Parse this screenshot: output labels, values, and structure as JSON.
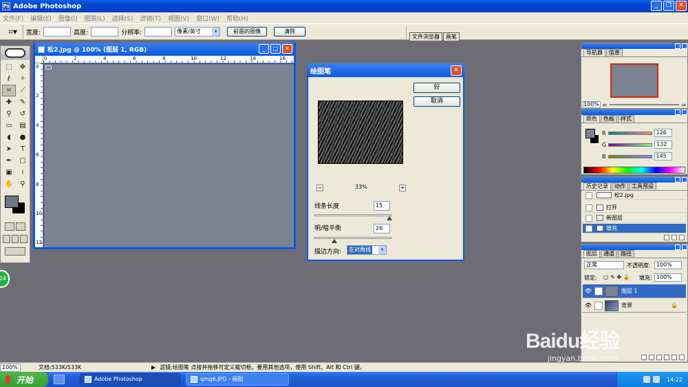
{
  "app": {
    "title": "Adobe Photoshop"
  },
  "menu": [
    "文件(F)",
    "编辑(E)",
    "图像(I)",
    "图层(L)",
    "选择(S)",
    "滤镜(T)",
    "视图(V)",
    "窗口(W)",
    "帮助(H)"
  ],
  "options": {
    "width_label": "宽度:",
    "height_label": "高度:",
    "resolution_label": "分辨率:",
    "unit_value": "像素/英寸",
    "front_image_button": "前面的图像",
    "clear_button": "清除",
    "well_tabs": [
      "文件浏览器",
      "画笔"
    ]
  },
  "document": {
    "title": "松2.jpg @ 100% (图层 1, RGB)",
    "ruler_h": [
      "0",
      "2",
      "4",
      "6",
      "8",
      "10",
      "12",
      "14",
      "16"
    ],
    "ruler_v": [
      "0",
      "2",
      "4",
      "6",
      "8",
      "10",
      "12"
    ]
  },
  "dialog": {
    "title": "绘图笔",
    "ok": "好",
    "cancel": "取消",
    "zoom": "33%",
    "zoom_minus": "−",
    "zoom_plus": "+",
    "stroke_length_label": "线条长度",
    "stroke_length": "15",
    "light_dark_label": "明/暗平衡",
    "light_dark": "26",
    "direction_label": "描边方向:",
    "direction": "左对角线"
  },
  "navigator": {
    "tabs": [
      "导航器",
      "信息"
    ],
    "zoom": "100%"
  },
  "color": {
    "tabs": [
      "颜色",
      "色板",
      "样式"
    ],
    "r_label": "R",
    "r": "126",
    "g_label": "G",
    "g": "132",
    "b_label": "B",
    "b": "145"
  },
  "history": {
    "tabs": [
      "历史记录",
      "动作",
      "工具预设"
    ],
    "snapshot": "松2.jpg",
    "items": [
      "打开",
      "新图层",
      "填充"
    ]
  },
  "layers": {
    "tabs": [
      "图层",
      "通道",
      "路径"
    ],
    "blend": "正常",
    "opacity_label": "不透明度:",
    "opacity": "100%",
    "lock_label": "锁定:",
    "fill_label": "填充:",
    "fill": "100%",
    "items": [
      "图层 1",
      "背景"
    ]
  },
  "status": {
    "zoom": "100%",
    "doc": "文档:533K/533K",
    "hint": "滤镜:绘图笔  点按并拖移可定义裁切框。要用其他选项，使用 Shift、Alt 和 Ctrl 键。"
  },
  "taskbar": {
    "start": "开始",
    "tasks": [
      "Adobe Photoshop",
      "qing6.JPG - 画图"
    ],
    "clock": "14:22"
  },
  "watermark": {
    "line1": "Baidu经验",
    "line2": "jingyan.baidu.com"
  },
  "badge": "24",
  "colors": {
    "canvas": "#7b8292",
    "selection": "#316ac5",
    "titlebar": "#0a5be0"
  }
}
